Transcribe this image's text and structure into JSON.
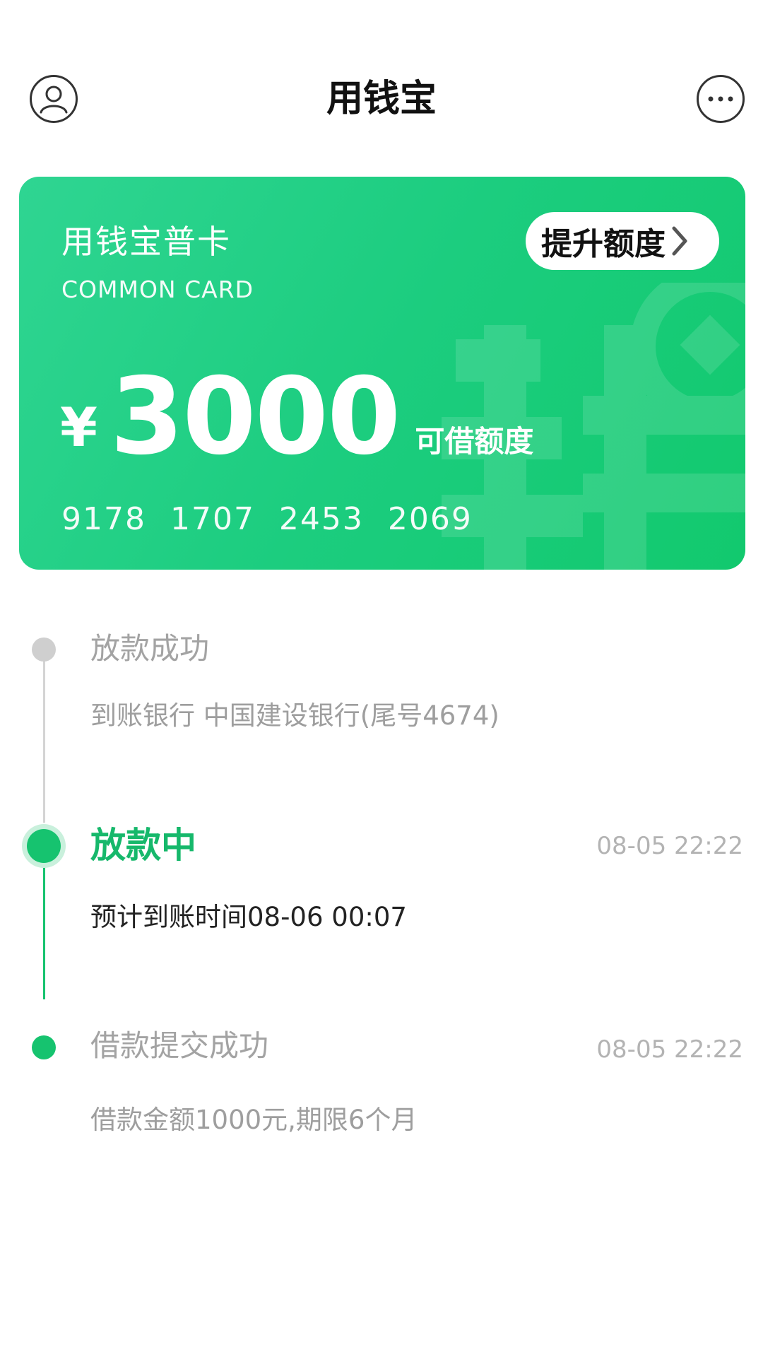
{
  "header": {
    "title": "用钱宝",
    "left_icon": "user-icon",
    "right_icon": "more-icon"
  },
  "card": {
    "name": "用钱宝普卡",
    "sub_name": "COMMON CARD",
    "upgrade_label": "提升额度",
    "currency": "¥",
    "amount": "3000",
    "amount_label": "可借额度",
    "number": "9178 1707 2453 2069",
    "gradient_start": "#2fd592",
    "gradient_end": "#12c96e"
  },
  "timeline": {
    "items": [
      {
        "title": "放款成功",
        "time": "",
        "desc": "到账银行 中国建设银行(尾号4674)",
        "state": "pending"
      },
      {
        "title": "放款中",
        "time": "08-05 22:22",
        "desc": "预计到账时间08-06 00:07",
        "state": "active"
      },
      {
        "title": "借款提交成功",
        "time": "08-05 22:22",
        "desc": "借款金额1000元,期限6个月",
        "state": "done"
      }
    ],
    "active_color": "#16c36f",
    "inactive_color": "#cfcfcf"
  }
}
